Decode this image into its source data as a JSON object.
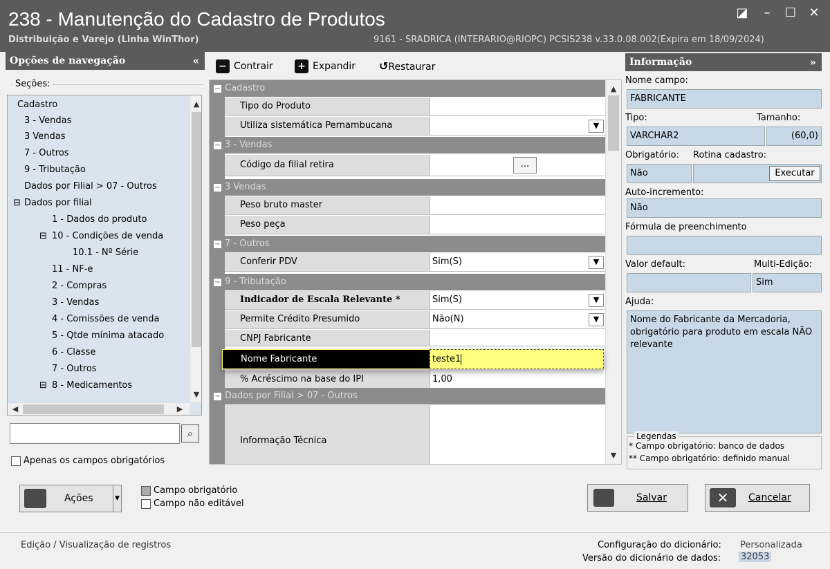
{
  "window": {
    "title": "238 - Manutenção do Cadastro de Produtos",
    "subtitle": "Distribuição e Varejo (Linha WinThor)",
    "info": "9161 - SRADRICA (INTERARIO@RIOPC)   PCSIS238  v.33.0.08.002(Expira em 18/09/2024)"
  },
  "nav": {
    "header": "Opções de navegação",
    "collapse": "«",
    "secoes": "Seções:",
    "apenas": "Apenas os campos obrigatórios",
    "items": [
      "Cadastro",
      "3 - Vendas",
      "3 Vendas",
      "7 - Outros",
      "9 - Tributação",
      "Dados por Filial > 07 - Outros",
      "Dados por filial",
      "1 - Dados do produto",
      "10 - Condições de venda",
      "10.1 - Nº Série",
      "11 - NF-e",
      "2 - Compras",
      "3 - Vendas",
      "4 - Comissões de venda",
      "5 - Qtde mínima atacado",
      "6 - Classe",
      "7 - Outros",
      "8 - Medicamentos"
    ]
  },
  "toolbar": {
    "contrair": "Contrair",
    "expandir": "Expandir",
    "restaurar": "Restaurar"
  },
  "grid": {
    "cat1": "Cadastro",
    "cat2": "3 - Vendas",
    "cat3": "3 Vendas",
    "cat4": "7 - Outros",
    "cat5": "9 - Tributação",
    "cat6": "Dados por Filial > 07 - Outros",
    "r1": "Tipo do Produto",
    "r2": "Utiliza sistemática Pernambucana",
    "r3": "Código da filial retira",
    "r4": "Peso bruto master",
    "r5": "Peso peça",
    "r6": "Conferir PDV",
    "r6v": "Sim(S)",
    "r7": "Indicador de Escala Relevante *",
    "r7v": "Sim(S)",
    "r8": "Permite Crédito Presumido",
    "r8v": "Não(N)",
    "r9": "CNPJ Fabricante",
    "r10": "Nome Fabricante",
    "r10v": "teste1",
    "r11": "% Acréscimo na base do IPI",
    "r11v": "1,00",
    "r12": "Informação Técnica",
    "ellipsis": "..."
  },
  "info": {
    "header": "Informação",
    "collapse": "»",
    "nome_label": "Nome campo:",
    "nome": "FABRICANTE",
    "tipo_label": "Tipo:",
    "tam_label": "Tamanho:",
    "tipo": "VARCHAR2",
    "tam": "(60,0)",
    "obrig_label": "Obrigatório:",
    "rotina_label": "Rotina cadastro:",
    "obrig": "Não",
    "executar": "Executar",
    "auto_label": "Auto-incremento:",
    "auto": "Não",
    "formula_label": "Fórmula de preenchimento",
    "default_label": "Valor default:",
    "multi_label": "Multi-Edição:",
    "multi": "Sim",
    "ajuda_label": "Ajuda:",
    "ajuda": "Nome do Fabricante da Mercadoria, obrigatório para produto em escala NÃO relevante",
    "legendas": "Legendas",
    "leg1": "* Campo obrigatório: banco de dados",
    "leg2": "** Campo obrigatório: definido manual"
  },
  "bottom": {
    "acoes": "Ações",
    "campo_obrig": "Campo obrigatório",
    "campo_nao": "Campo não editável",
    "salvar": "Salvar",
    "cancelar": "Cancelar"
  },
  "status": {
    "left": "Edição / Visualização de registros",
    "config_label": "Configuração do dicionário:",
    "config": "Personalizada",
    "versao_label": "Versão do dicionário de dados:",
    "versao": "32053"
  }
}
